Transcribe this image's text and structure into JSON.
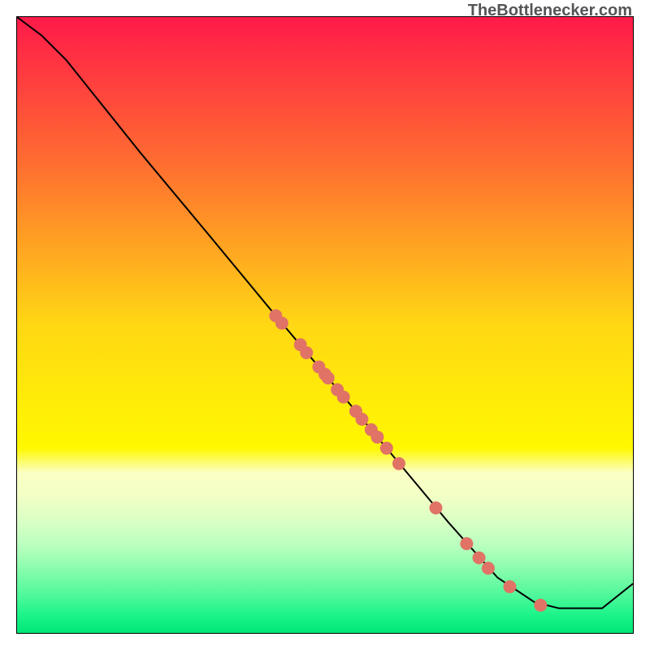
{
  "chart_data": {
    "type": "line",
    "watermark": "TheBottlenecker.com",
    "xlim": [
      0,
      100
    ],
    "ylim": [
      0,
      100
    ],
    "curve": [
      {
        "x": 0,
        "y": 100
      },
      {
        "x": 4,
        "y": 97
      },
      {
        "x": 8,
        "y": 93
      },
      {
        "x": 12,
        "y": 88
      },
      {
        "x": 20,
        "y": 78
      },
      {
        "x": 30,
        "y": 66
      },
      {
        "x": 42,
        "y": 51.5
      },
      {
        "x": 50,
        "y": 42
      },
      {
        "x": 60,
        "y": 30
      },
      {
        "x": 70,
        "y": 18
      },
      {
        "x": 78,
        "y": 9
      },
      {
        "x": 84,
        "y": 5
      },
      {
        "x": 88,
        "y": 4
      },
      {
        "x": 95,
        "y": 4
      },
      {
        "x": 100,
        "y": 8
      }
    ],
    "points": [
      {
        "x": 42,
        "y": 51.5
      },
      {
        "x": 43,
        "y": 50.3
      },
      {
        "x": 46,
        "y": 46.8
      },
      {
        "x": 47,
        "y": 45.5
      },
      {
        "x": 49,
        "y": 43.2
      },
      {
        "x": 50,
        "y": 42
      },
      {
        "x": 50.5,
        "y": 41.4
      },
      {
        "x": 52,
        "y": 39.5
      },
      {
        "x": 53,
        "y": 38.3
      },
      {
        "x": 55,
        "y": 36
      },
      {
        "x": 56,
        "y": 34.7
      },
      {
        "x": 57.5,
        "y": 33
      },
      {
        "x": 58.5,
        "y": 31.8
      },
      {
        "x": 60,
        "y": 30
      },
      {
        "x": 62,
        "y": 27.5
      },
      {
        "x": 68,
        "y": 20.3
      },
      {
        "x": 73,
        "y": 14.5
      },
      {
        "x": 75,
        "y": 12.2
      },
      {
        "x": 76.5,
        "y": 10.5
      },
      {
        "x": 80,
        "y": 7.5
      },
      {
        "x": 85,
        "y": 4.5
      }
    ],
    "gradient_stops": [
      {
        "offset": 0,
        "color": "#ff1a4a"
      },
      {
        "offset": 25,
        "color": "#ff722f"
      },
      {
        "offset": 50,
        "color": "#ffd814"
      },
      {
        "offset": 70,
        "color": "#fff800"
      },
      {
        "offset": 74,
        "color": "#fbffc5"
      },
      {
        "offset": 78,
        "color": "#f1ffc5"
      },
      {
        "offset": 82,
        "color": "#d9ffc5"
      },
      {
        "offset": 86,
        "color": "#b7ffbd"
      },
      {
        "offset": 90,
        "color": "#84fcab"
      },
      {
        "offset": 94,
        "color": "#4df89a"
      },
      {
        "offset": 97,
        "color": "#1df48a"
      },
      {
        "offset": 100,
        "color": "#00e676"
      }
    ],
    "point_color": "#e07366",
    "curve_color": "#000000"
  }
}
